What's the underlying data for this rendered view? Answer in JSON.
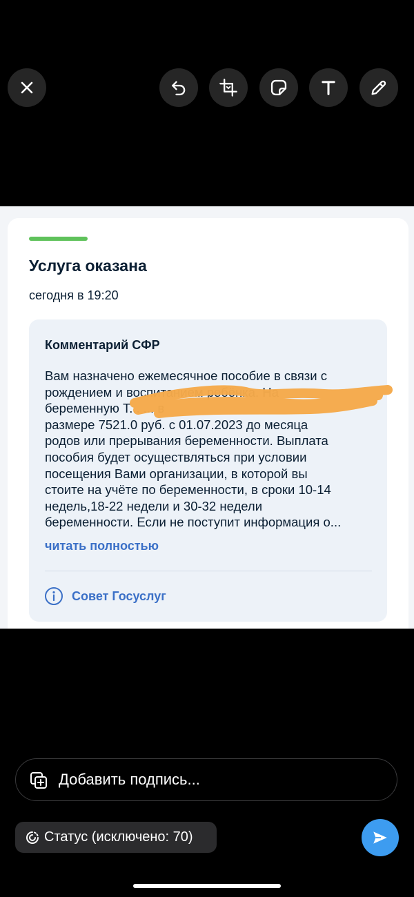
{
  "toolbar": {
    "icons": [
      "close-icon",
      "undo-icon",
      "crop-rotate-icon",
      "sticker-icon",
      "text-icon",
      "pencil-icon"
    ]
  },
  "card": {
    "title": "Услуга оказана",
    "time": "сегодня в 19:20",
    "status_color": "#5fc25b",
    "comment": {
      "title": "Комментарий СФР",
      "lines": [
        "Вам назначено ежемесячное пособие в связи с",
        "рождением и воспитанием ребёнка. На",
        "беременную Т... ... в",
        "размере 7521.0 руб. с 01.07.2023 до месяца",
        "родов или прерывания беременности. Выплата",
        "пособия будет осуществляться при условии",
        "посещения Вами организации, в которой вы",
        "стоите на учёте по беременности, в сроки 10-14",
        "недель,18-22 недели и 30-32 недели",
        "беременности. Если не поступит информация о..."
      ],
      "read_more": "читать полностью"
    },
    "tip": {
      "icon": "info-icon",
      "label": "Совет Госуслуг"
    },
    "scribble_color": "#f5a94a"
  },
  "caption": {
    "placeholder": "Добавить подпись..."
  },
  "status_chip": {
    "label": "Статус (исключено: 70)"
  },
  "colors": {
    "accent_blue": "#3b70c7",
    "send_button": "#3d9cf0"
  }
}
